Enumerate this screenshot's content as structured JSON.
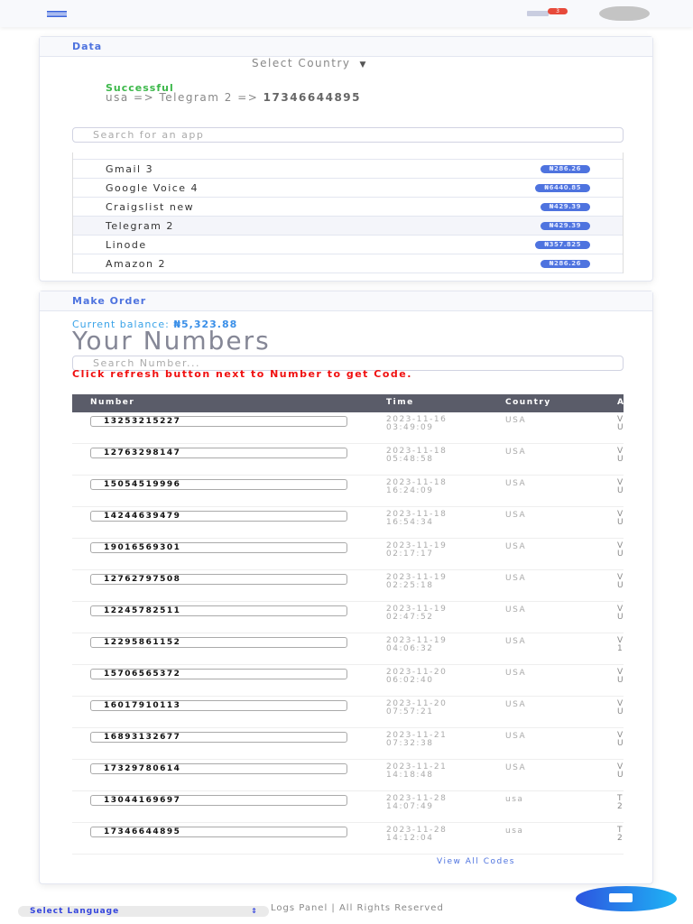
{
  "topbar": {
    "notification_count": "3"
  },
  "data_card": {
    "title": "Data",
    "select_country": "Select Country",
    "status": "Successful",
    "result_prefix": "usa => Telegram 2 =>",
    "result_number": "17346644895",
    "search_placeholder": "Search for an app",
    "apps": [
      {
        "name": "Gmail 3",
        "price": "₦286.26"
      },
      {
        "name": "Google Voice 4",
        "price": "₦6440.85"
      },
      {
        "name": "Craigslist new",
        "price": "₦429.39"
      },
      {
        "name": "Telegram 2",
        "price": "₦429.39"
      },
      {
        "name": "Linode",
        "price": "₦357.825"
      },
      {
        "name": "Amazon 2",
        "price": "₦286.26"
      }
    ]
  },
  "order_card": {
    "title": "Make Order",
    "balance_label": "Current balance:",
    "balance_value": "₦5,323.88",
    "heading": "Your Numbers",
    "search_placeholder": "Search Number...",
    "warning": "Click refresh button next to Number to get Code.",
    "columns": [
      "Number",
      "Time",
      "Country",
      "A"
    ],
    "rows": [
      {
        "number": "13253215227",
        "time": "2023-11-16 03:49:09",
        "country": "USA",
        "extra": "V\nU"
      },
      {
        "number": "12763298147",
        "time": "2023-11-18 05:48:58",
        "country": "USA",
        "extra": "V\nU"
      },
      {
        "number": "15054519996",
        "time": "2023-11-18 16:24:09",
        "country": "USA",
        "extra": "V\nU"
      },
      {
        "number": "14244639479",
        "time": "2023-11-18 16:54:34",
        "country": "USA",
        "extra": "V\nU"
      },
      {
        "number": "19016569301",
        "time": "2023-11-19 02:17:17",
        "country": "USA",
        "extra": "V\nU"
      },
      {
        "number": "12762797508",
        "time": "2023-11-19 02:25:18",
        "country": "USA",
        "extra": "V\nU"
      },
      {
        "number": "12245782511",
        "time": "2023-11-19 02:47:52",
        "country": "USA",
        "extra": "V\nU"
      },
      {
        "number": "12295861152",
        "time": "2023-11-19 04:06:32",
        "country": "USA",
        "extra": "V\n1"
      },
      {
        "number": "15706565372",
        "time": "2023-11-20 06:02:40",
        "country": "USA",
        "extra": "V\nU"
      },
      {
        "number": "16017910113",
        "time": "2023-11-20 07:57:21",
        "country": "USA",
        "extra": "V\nU"
      },
      {
        "number": "16893132677",
        "time": "2023-11-21 07:32:38",
        "country": "USA",
        "extra": "V\nU"
      },
      {
        "number": "17329780614",
        "time": "2023-11-21 14:18:48",
        "country": "USA",
        "extra": "V\nU"
      },
      {
        "number": "13044169697",
        "time": "2023-11-28 14:07:49",
        "country": "usa",
        "extra": "T\n2"
      },
      {
        "number": "17346644895",
        "time": "2023-11-28 14:12:04",
        "country": "usa",
        "extra": "T\n2"
      }
    ],
    "view_all": "View All Codes"
  },
  "footer": {
    "language": "Select Language",
    "text": "Logs Panel | All Rights Reserved"
  }
}
